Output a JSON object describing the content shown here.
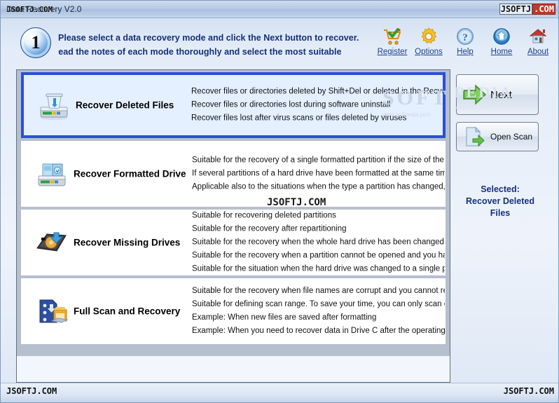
{
  "window": {
    "title": "Data Recovery V2.0",
    "watermark_left": "JSOFTJ.COM",
    "watermark_right_plain": "JSOFTJ",
    "watermark_right_red": ".COM"
  },
  "header": {
    "step_number": "1",
    "line1": "Please select a data recovery mode and click the Next button to recover.",
    "line2": "se read the notes of each mode thoroughly and select the most suitable"
  },
  "toolbar": {
    "items": [
      {
        "label": "Register",
        "icon": "cart-check-icon"
      },
      {
        "label": "Options",
        "icon": "gear-icon"
      },
      {
        "label": "Help",
        "icon": "question-circle-icon"
      },
      {
        "label": "Home",
        "icon": "home-circle-icon"
      },
      {
        "label": "About",
        "icon": "house-icon"
      }
    ]
  },
  "modes": [
    {
      "title": "Recover Deleted Files",
      "icon": "drive-recycle-bin-icon",
      "selected": true,
      "lines": [
        "Recover files or directories deleted by Shift+Del or deleted in the Recycle B",
        "Recover files or directories lost during software uninstall",
        "Recover files lost after virus scans or files deleted by viruses"
      ]
    },
    {
      "title": "Recover Formatted Drive",
      "icon": "drive-formatted-icon",
      "selected": false,
      "lines": [
        "Suitable for the recovery of a single formatted partition if the size of the pa",
        "If several partitions of a hard drive have been formatted at the same time,",
        "Applicable also to the situations when the type a partition has changed, su"
      ]
    },
    {
      "title": "Recover Missing Drives",
      "icon": "drive-missing-icon",
      "selected": false,
      "lines": [
        "Suitable for recovering deleted partitions",
        "Suitable for the recovery after repartitioning",
        "Suitable for the recovery when the whole hard drive has been changed to",
        "Suitable for the recovery when a partition cannot be opened and you have",
        "Suitable for the situation when the hard drive was changed to a single part"
      ]
    },
    {
      "title": "Full Scan and Recovery",
      "icon": "full-scan-icon",
      "selected": false,
      "lines": [
        "Suitable for the recovery when file names are corrupt and you cannot reco",
        "Suitable for defining scan range. To save your time, you can only scan cert",
        "Example: When new files are saved after formatting",
        "Example: When you need to recover data in Drive C after the operating sy"
      ]
    }
  ],
  "sidebar": {
    "next_label": "Next",
    "open_scan_label": "Open Scan",
    "selected_caption": "Selected:",
    "selected_value_line1": "Recover Deleted",
    "selected_value_line2": "Files"
  },
  "footer": {
    "watermark_left": "JSOFTJ.COM",
    "watermark_right": "JSOFTJ.COM"
  },
  "overlays": {
    "center_watermark": "JSOFTJ.COM",
    "faint_soft": "SOFT",
    "faint_soft_sub": "www.softpedia.com",
    "faint_next": "PEDIA",
    "faint_next_sub": "softpedia.com"
  },
  "colors": {
    "accent_blue": "#2b4fd8",
    "title_text": "#14307a",
    "selected_bg": "#e4efff"
  }
}
